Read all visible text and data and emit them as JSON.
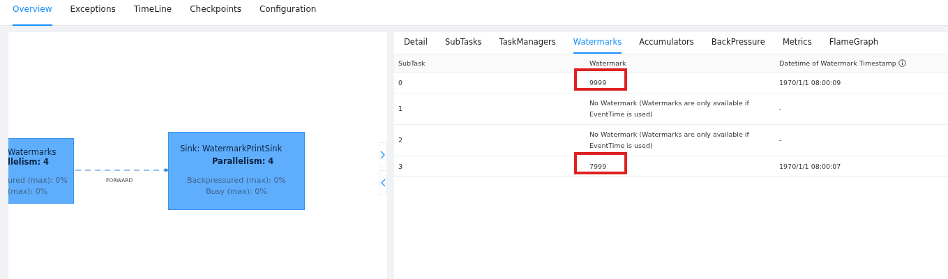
{
  "top_tabs": [
    {
      "label": "Overview",
      "selected": true
    },
    {
      "label": "Exceptions",
      "selected": false
    },
    {
      "label": "TimeLine",
      "selected": false
    },
    {
      "label": "Checkpoints",
      "selected": false
    },
    {
      "label": "Configuration",
      "selected": false
    }
  ],
  "graph": {
    "nodes": [
      {
        "lines": [
          "Watermarks",
          "llelism: 4"
        ],
        "metrics": [
          "ured (max): 0%",
          "(max): 0%"
        ],
        "clipped": true
      },
      {
        "lines": [
          "Sink: WatermarkPrintSink",
          "Parallelism: 4"
        ],
        "metrics": [
          "Backpressured (max): 0%",
          "Busy (max): 0%"
        ],
        "clipped": false
      }
    ],
    "edge_label": "FORWARD"
  },
  "detail_tabs": [
    {
      "label": "Detail",
      "selected": false
    },
    {
      "label": "SubTasks",
      "selected": false
    },
    {
      "label": "TaskManagers",
      "selected": false
    },
    {
      "label": "Watermarks",
      "selected": true
    },
    {
      "label": "Accumulators",
      "selected": false
    },
    {
      "label": "BackPressure",
      "selected": false
    },
    {
      "label": "Metrics",
      "selected": false
    },
    {
      "label": "FlameGraph",
      "selected": false
    }
  ],
  "table": {
    "columns": [
      "SubTask",
      "Watermark",
      "Datetime of Watermark Timestamp"
    ],
    "rows": [
      {
        "subtask": "0",
        "watermark": "9999",
        "datetime": "1970/1/1 08:00:09",
        "highlighted": true
      },
      {
        "subtask": "1",
        "watermark": "No Watermark (Watermarks are only available if EventTime is used)",
        "datetime": "-",
        "highlighted": false
      },
      {
        "subtask": "2",
        "watermark": "No Watermark (Watermarks are only available if EventTime is used)",
        "datetime": "-",
        "highlighted": false
      },
      {
        "subtask": "3",
        "watermark": "7999",
        "datetime": "1970/1/1 08:00:07",
        "highlighted": true
      }
    ]
  }
}
